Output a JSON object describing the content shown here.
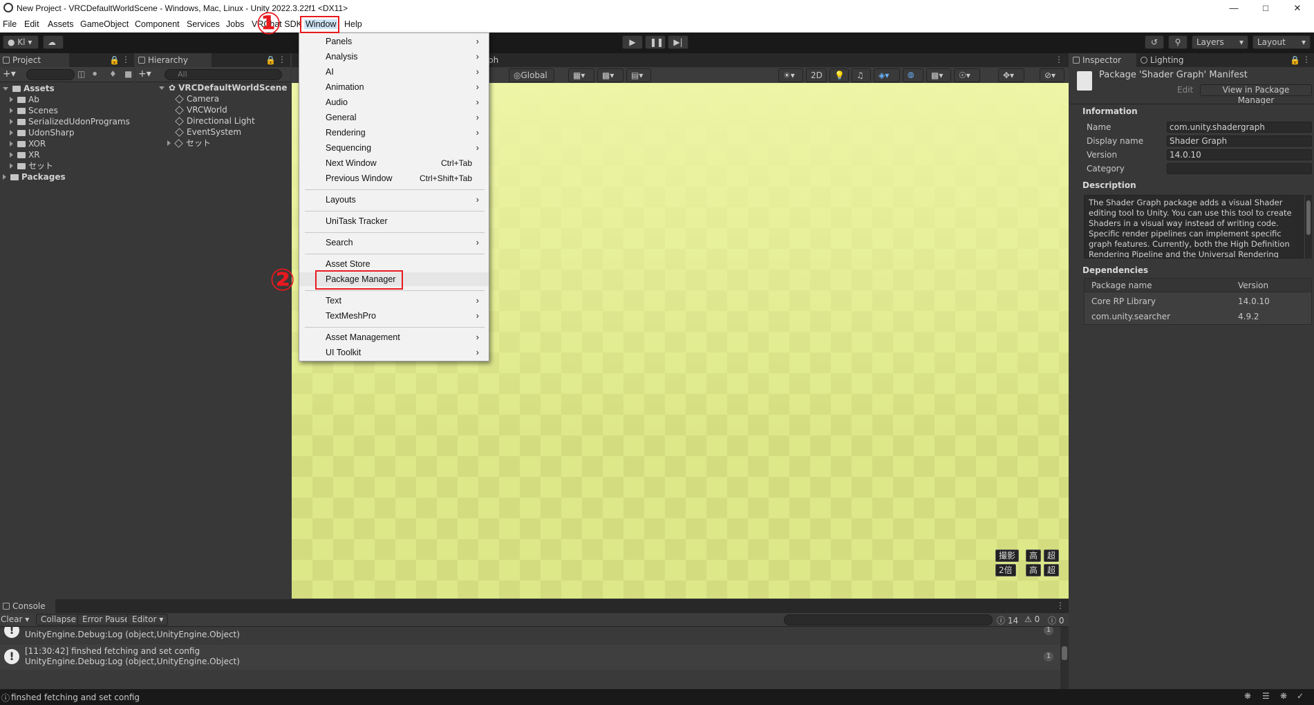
{
  "window": {
    "title": "New Project - VRCDefaultWorldScene - Windows, Mac, Linux - Unity 2022.3.22f1 <DX11>"
  },
  "menubar": {
    "items": [
      "File",
      "Edit",
      "Assets",
      "GameObject",
      "Component",
      "Services",
      "Jobs",
      "VRChat SDK",
      "Window",
      "Help"
    ]
  },
  "toolbar": {
    "account": "Kl",
    "layers": "Layers",
    "layout": "Layout"
  },
  "project": {
    "tab": "Project",
    "tree": [
      {
        "label": "Assets",
        "level": 0,
        "bold": true,
        "expanded": true
      },
      {
        "label": "Ab",
        "level": 1
      },
      {
        "label": "Scenes",
        "level": 1
      },
      {
        "label": "SerializedUdonPrograms",
        "level": 1
      },
      {
        "label": "UdonSharp",
        "level": 1
      },
      {
        "label": "XOR",
        "level": 1
      },
      {
        "label": "XR",
        "level": 1
      },
      {
        "label": "セット",
        "level": 1
      },
      {
        "label": "Packages",
        "level": 0,
        "bold": true
      }
    ]
  },
  "hierarchy": {
    "tab": "Hierarchy",
    "search_placeholder": "All",
    "scene": "VRCDefaultWorldScene",
    "items": [
      "Camera",
      "VRCWorld",
      "Directional Light",
      "EventSystem",
      "セット"
    ]
  },
  "scene": {
    "tab_fragment": "ph",
    "global": "Global",
    "mode_2d": "2D",
    "overlay_row1": [
      "撮影",
      "高",
      "超"
    ],
    "overlay_row2": [
      "2倍",
      "高",
      "超"
    ]
  },
  "window_menu": {
    "items": [
      {
        "label": "Panels",
        "submenu": true
      },
      {
        "label": "Analysis",
        "submenu": true
      },
      {
        "label": "AI",
        "submenu": true
      },
      {
        "label": "Animation",
        "submenu": true
      },
      {
        "label": "Audio",
        "submenu": true
      },
      {
        "label": "General",
        "submenu": true
      },
      {
        "label": "Rendering",
        "submenu": true
      },
      {
        "label": "Sequencing",
        "submenu": true
      },
      {
        "label": "Next Window",
        "shortcut": "Ctrl+Tab"
      },
      {
        "label": "Previous Window",
        "shortcut": "Ctrl+Shift+Tab"
      },
      {
        "label": "Layouts",
        "submenu": true
      },
      {
        "label": "UniTask Tracker"
      },
      {
        "label": "Search",
        "submenu": true
      },
      {
        "label": "Asset Store"
      },
      {
        "label": "Package Manager",
        "highlighted": true
      },
      {
        "label": "Text",
        "submenu": true
      },
      {
        "label": "TextMeshPro",
        "submenu": true
      },
      {
        "label": "Asset Management",
        "submenu": true
      },
      {
        "label": "UI Toolkit",
        "submenu": true
      }
    ]
  },
  "annotations": {
    "step1": "①",
    "step2": "②",
    "highlight_color": "#e8191e"
  },
  "inspector": {
    "tabs": [
      "Inspector",
      "Lighting"
    ],
    "header_title": "Package 'Shader Graph' Manifest",
    "edit_button": "Edit",
    "view_button": "View in Package Manager",
    "information_header": "Information",
    "fields": [
      {
        "label": "Name",
        "value": "com.unity.shadergraph"
      },
      {
        "label": "Display name",
        "value": "Shader Graph"
      },
      {
        "label": "Version",
        "value": "14.0.10"
      },
      {
        "label": "Category",
        "value": ""
      }
    ],
    "description_header": "Description",
    "description": "The Shader Graph package adds a visual Shader editing tool to Unity. You can use this tool to create Shaders in a visual way instead of writing code. Specific render pipelines can implement specific graph features. Currently, both the High Definition Rendering Pipeline and the Universal Rendering",
    "dependencies_header": "Dependencies",
    "dep_columns": [
      "Package name",
      "Version"
    ],
    "dependencies": [
      {
        "name": "Core RP Library",
        "version": "14.0.10"
      },
      {
        "name": "com.unity.searcher",
        "version": "4.9.2"
      }
    ]
  },
  "console": {
    "tab": "Console",
    "buttons": [
      "Clear",
      "Collapse",
      "Error Pause",
      "Editor"
    ],
    "counts": {
      "log": "14",
      "warn": "0",
      "error": "0"
    },
    "entries": [
      {
        "line1": "",
        "line2": "UnityEngine.Debug:Log (object,UnityEngine.Object)",
        "count": "1"
      },
      {
        "line1": "[11:30:42] finshed fetching and set config",
        "line2": "UnityEngine.Debug:Log (object,UnityEngine.Object)",
        "count": "1"
      }
    ]
  },
  "statusbar": {
    "message": "finshed fetching and set config"
  }
}
